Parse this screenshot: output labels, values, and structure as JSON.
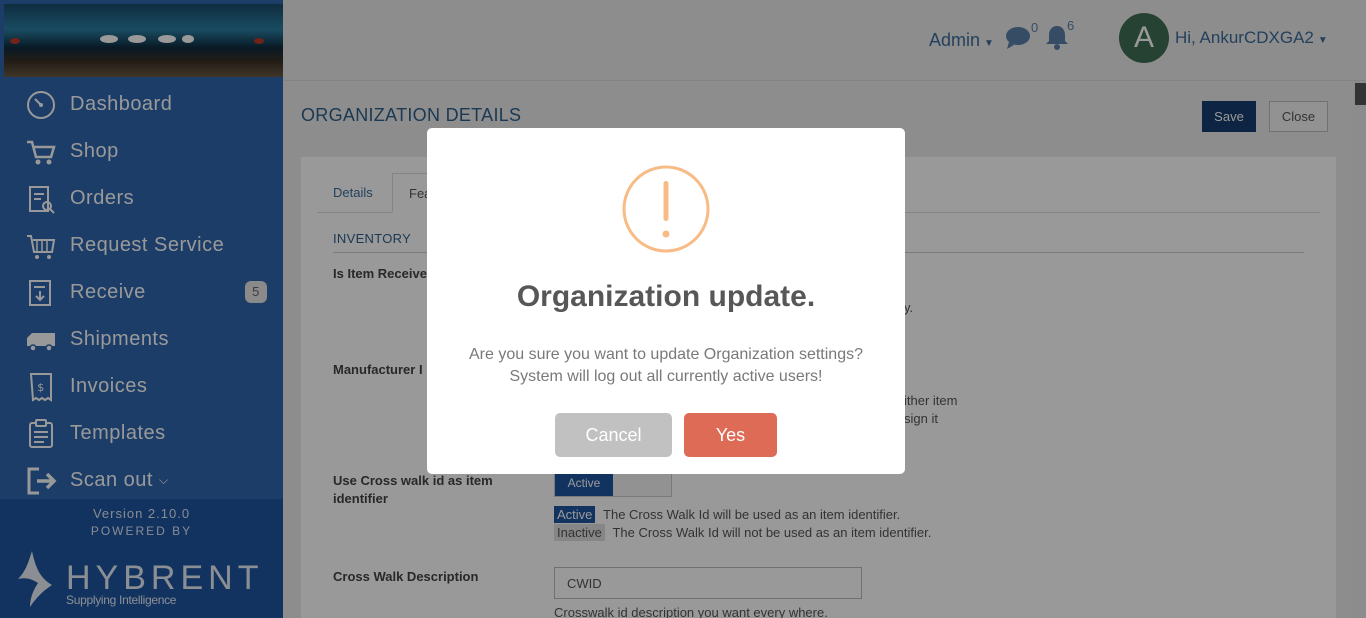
{
  "header": {
    "admin_label": "Admin",
    "chat_count": "0",
    "notification_count": "6",
    "avatar_letter": "A",
    "greeting": "Hi, AnkurCDXGA2"
  },
  "sidebar": {
    "items": [
      {
        "label": "Dashboard",
        "icon": "dashboard-icon"
      },
      {
        "label": "Shop",
        "icon": "cart-icon"
      },
      {
        "label": "Orders",
        "icon": "orders-icon"
      },
      {
        "label": "Request Service",
        "icon": "request-service-icon"
      },
      {
        "label": "Receive",
        "icon": "receive-icon",
        "badge": "5"
      },
      {
        "label": "Shipments",
        "icon": "truck-icon"
      },
      {
        "label": "Invoices",
        "icon": "invoice-icon"
      },
      {
        "label": "Templates",
        "icon": "templates-icon"
      },
      {
        "label": "Scan out",
        "icon": "scan-out-icon"
      }
    ],
    "version": "Version 2.10.0",
    "powered_by": "POWERED BY",
    "brand_name": "HYBRENT",
    "brand_tagline": "Supplying Intelligence"
  },
  "main": {
    "page_title": "ORGANIZATION DETAILS",
    "save_label": "Save",
    "close_label": "Close",
    "tabs": [
      {
        "label": "Details"
      },
      {
        "label": "Fea"
      }
    ],
    "section_title": "INVENTORY",
    "field_is_item_receive": "Is Item Receive",
    "field_is_item_receive_tail": "y.",
    "field_manufacturer": "Manufacturer I",
    "manufacturer_text_1": "ither item",
    "manufacturer_text_2": "sign it",
    "field_cross_walk": "Use Cross walk id as item identifier",
    "toggle_active": "Active",
    "active_tag": "Active",
    "active_desc": "The Cross Walk Id will be used as an item identifier.",
    "inactive_tag": "Inactive",
    "inactive_desc": "The Cross Walk Id will not be used as an item identifier.",
    "field_cross_walk_desc": "Cross Walk Description",
    "cross_walk_value": "CWID",
    "cross_walk_help": "Crosswalk id description you want every where."
  },
  "modal": {
    "title": "Organization update.",
    "line1": "Are you sure you want to update Organization settings?",
    "line2": "System will log out all currently active users!",
    "cancel_label": "Cancel",
    "yes_label": "Yes",
    "icon": "warning-icon",
    "accent_color": "#f8bb86",
    "confirm_color": "#dd6b55"
  }
}
